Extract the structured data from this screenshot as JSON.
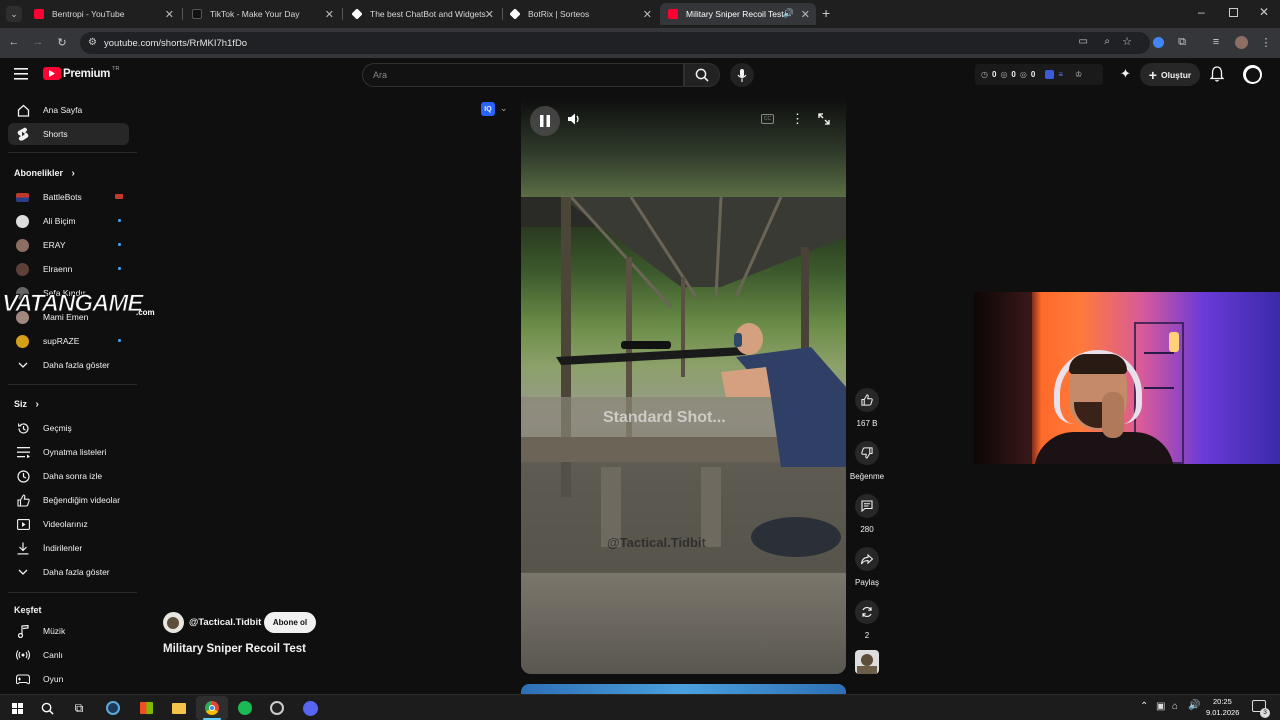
{
  "browser": {
    "tabs": [
      {
        "title": "Bentropi - YouTube",
        "color": "#ff0033"
      },
      {
        "title": "TikTok - Make Your Day",
        "color": "#111111"
      },
      {
        "title": "The best ChatBot and Widgets",
        "color": "#ffffff"
      },
      {
        "title": "BotRix | Sorteos",
        "color": "#ffffff"
      },
      {
        "title": "Military Sniper Recoil Test -",
        "color": "#ff0033"
      }
    ],
    "url": "youtube.com/shorts/RrMKI7h1fDo"
  },
  "header": {
    "logo_text": "Premium",
    "region": "TR",
    "search_placeholder": "Ara",
    "counters": [
      "0",
      "0",
      "0"
    ],
    "create_label": "Oluştur"
  },
  "sidebar": {
    "main": [
      {
        "label": "Ana Sayfa",
        "icon": "home-icon"
      },
      {
        "label": "Shorts",
        "icon": "shorts-icon"
      }
    ],
    "subs_header": "Abonelikler",
    "subs": [
      {
        "label": "BattleBots",
        "color": "#c0392b"
      },
      {
        "label": "Ali Biçim",
        "color": "#dddddd"
      },
      {
        "label": "ERAY",
        "color": "#8d6e63"
      },
      {
        "label": "Elraenn",
        "color": "#5d4037"
      },
      {
        "label": "Sefa Kındır",
        "color": "#666666"
      },
      {
        "label": "Mami Emen",
        "color": "#a1887f"
      },
      {
        "label": "supRAZE",
        "color": "#d4a017"
      }
    ],
    "more_label": "Daha fazla göster",
    "you_header": "Siz",
    "you_items": [
      {
        "label": "Geçmiş",
        "icon": "history-icon"
      },
      {
        "label": "Oynatma listeleri",
        "icon": "playlist-icon"
      },
      {
        "label": "Daha sonra izle",
        "icon": "clock-icon"
      },
      {
        "label": "Beğendiğim videolar",
        "icon": "thumbs-up-icon"
      },
      {
        "label": "Videolarınız",
        "icon": "video-icon"
      },
      {
        "label": "İndirilenler",
        "icon": "download-icon"
      },
      {
        "label": "Daha fazla göster",
        "icon": "chevron-down-icon"
      }
    ],
    "explore_header": "Keşfet",
    "explore_items": [
      {
        "label": "Müzik",
        "icon": "music-icon"
      },
      {
        "label": "Canlı",
        "icon": "live-icon"
      },
      {
        "label": "Oyun",
        "icon": "gamepad-icon"
      }
    ]
  },
  "watermark": {
    "text": "VATANGAME",
    "sub": ".com"
  },
  "short": {
    "channel": "@Tactical.Tidbit",
    "subscribe_label": "Abone ol",
    "title": "Military Sniper Recoil Test",
    "overlay_text": "Standard Shot...",
    "overlay_handle": "@Tactical.Tidbit",
    "likes": "167 B",
    "dislike_label": "Beğenme",
    "comments": "280",
    "share_label": "Paylaş",
    "remix_count": "2"
  },
  "taskbar": {
    "time": "20:25",
    "date": "9.01.2026",
    "notif_count": "3"
  }
}
